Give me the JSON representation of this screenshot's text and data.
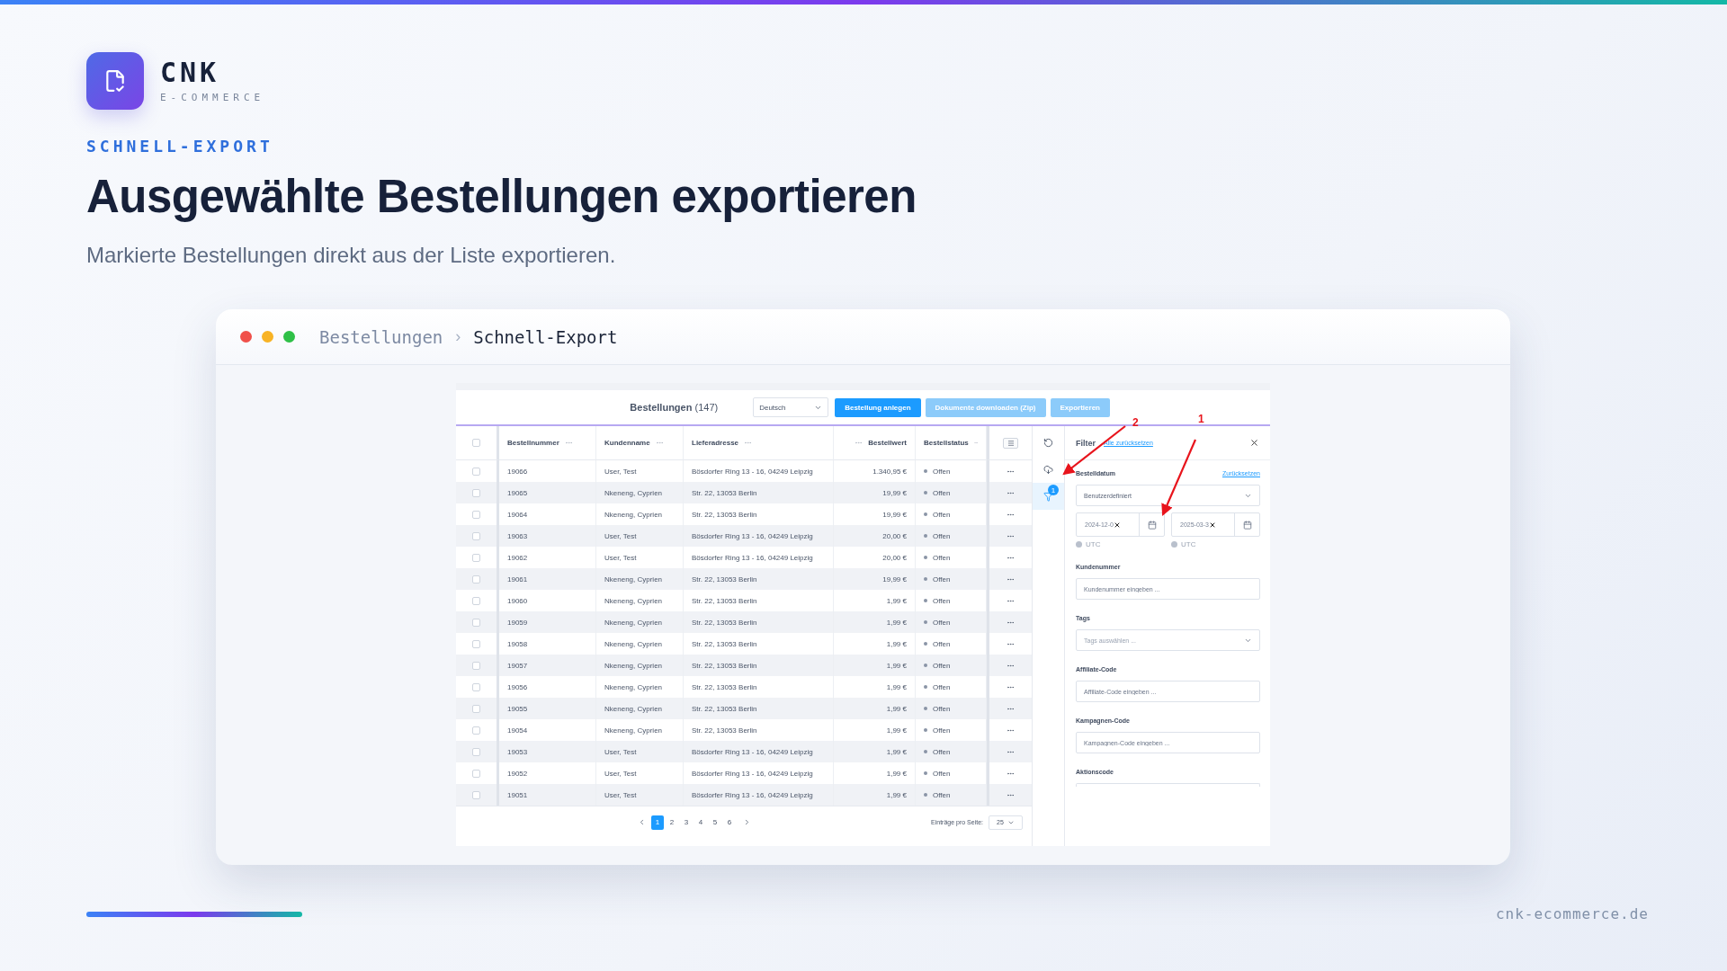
{
  "brand": {
    "name": "CNK",
    "tagline": "E-COMMERCE"
  },
  "eyebrow": "SCHNELL-EXPORT",
  "headline": "Ausgewählte Bestellungen exportieren",
  "subtitle": "Markierte Bestellungen direkt aus der Liste exportieren.",
  "window": {
    "breadcrumb": [
      {
        "label": "Bestellungen",
        "current": false
      },
      {
        "label": "Schnell-Export",
        "current": true
      }
    ],
    "separator": "›"
  },
  "app": {
    "title": "Bestellungen",
    "count": "(147)",
    "language": "Deutsch",
    "buttons": [
      {
        "label": "Bestellung anlegen",
        "disabled": false
      },
      {
        "label": "Dokumente downloaden (Zip)",
        "disabled": true
      },
      {
        "label": "Exportieren",
        "disabled": true
      }
    ],
    "select_all": false,
    "columns": [
      {
        "label": "Bestellnummer",
        "kind": "text"
      },
      {
        "label": "Kundenname",
        "kind": "text"
      },
      {
        "label": "Lieferadresse",
        "kind": "text"
      },
      {
        "label": "Bestellwert",
        "kind": "money"
      },
      {
        "label": "Bestellstatus",
        "kind": "status"
      }
    ],
    "rows": [
      {
        "checked": false,
        "cells": [
          "19066",
          "User, Test",
          "Bösdorfer Ring 13 - 16, 04249 Leipzig",
          "1.340,95 €",
          "Offen"
        ]
      },
      {
        "checked": false,
        "cells": [
          "19065",
          "Nkeneng, Cyprien",
          "Str. 22, 13053 Berlin",
          "19,99 €",
          "Offen"
        ]
      },
      {
        "checked": false,
        "cells": [
          "19064",
          "Nkeneng, Cyprien",
          "Str. 22, 13053 Berlin",
          "19,99 €",
          "Offen"
        ]
      },
      {
        "checked": false,
        "cells": [
          "19063",
          "User, Test",
          "Bösdorfer Ring 13 - 16, 04249 Leipzig",
          "20,00 €",
          "Offen"
        ]
      },
      {
        "checked": false,
        "cells": [
          "19062",
          "User, Test",
          "Bösdorfer Ring 13 - 16, 04249 Leipzig",
          "20,00 €",
          "Offen"
        ]
      },
      {
        "checked": false,
        "cells": [
          "19061",
          "Nkeneng, Cyprien",
          "Str. 22, 13053 Berlin",
          "19,99 €",
          "Offen"
        ]
      },
      {
        "checked": false,
        "cells": [
          "19060",
          "Nkeneng, Cyprien",
          "Str. 22, 13053 Berlin",
          "1,99 €",
          "Offen"
        ]
      },
      {
        "checked": false,
        "cells": [
          "19059",
          "Nkeneng, Cyprien",
          "Str. 22, 13053 Berlin",
          "1,99 €",
          "Offen"
        ]
      },
      {
        "checked": false,
        "cells": [
          "19058",
          "Nkeneng, Cyprien",
          "Str. 22, 13053 Berlin",
          "1,99 €",
          "Offen"
        ]
      },
      {
        "checked": false,
        "cells": [
          "19057",
          "Nkeneng, Cyprien",
          "Str. 22, 13053 Berlin",
          "1,99 €",
          "Offen"
        ]
      },
      {
        "checked": false,
        "cells": [
          "19056",
          "Nkeneng, Cyprien",
          "Str. 22, 13053 Berlin",
          "1,99 €",
          "Offen"
        ]
      },
      {
        "checked": false,
        "cells": [
          "19055",
          "Nkeneng, Cyprien",
          "Str. 22, 13053 Berlin",
          "1,99 €",
          "Offen"
        ]
      },
      {
        "checked": false,
        "cells": [
          "19054",
          "Nkeneng, Cyprien",
          "Str. 22, 13053 Berlin",
          "1,99 €",
          "Offen"
        ]
      },
      {
        "checked": false,
        "cells": [
          "19053",
          "User, Test",
          "Bösdorfer Ring 13 - 16, 04249 Leipzig",
          "1,99 €",
          "Offen"
        ]
      },
      {
        "checked": false,
        "cells": [
          "19052",
          "User, Test",
          "Bösdorfer Ring 13 - 16, 04249 Leipzig",
          "1,99 €",
          "Offen"
        ]
      },
      {
        "checked": false,
        "cells": [
          "19051",
          "User, Test",
          "Bösdorfer Ring 13 - 16, 04249 Leipzig",
          "1,99 €",
          "Offen"
        ]
      }
    ],
    "pagination": {
      "pages": [
        {
          "label": "1",
          "selected": true
        },
        {
          "label": "2",
          "selected": false
        },
        {
          "label": "3",
          "selected": false
        },
        {
          "label": "4",
          "selected": false
        },
        {
          "label": "5",
          "selected": false
        },
        {
          "label": "6",
          "selected": false
        }
      ],
      "per_page_label": "Einträge pro Seite:",
      "per_page": "25"
    },
    "side_tools": [
      {
        "kind": "refresh",
        "selected": false
      },
      {
        "kind": "download",
        "selected": false
      },
      {
        "kind": "filter",
        "selected": true,
        "badge": "1"
      }
    ],
    "filter": {
      "title": "Filter",
      "reset_all": "Alle zurücksetzen",
      "sections": [
        {
          "kind": "date",
          "label": "Bestelldatum",
          "reset": "Zurücksetzen",
          "value": "Benutzerdefiniert",
          "dates": [
            {
              "value": "2024-12-0",
              "hint": "UTC"
            },
            {
              "value": "2025-03-3",
              "hint": "UTC"
            }
          ]
        },
        {
          "kind": "input",
          "label": "Kundenummer",
          "placeholder": "Kundenummer eingeben ..."
        },
        {
          "kind": "select",
          "label": "Tags",
          "placeholder": "Tags auswählen ..."
        },
        {
          "kind": "input",
          "label": "Affiliate-Code",
          "placeholder": "Affiliate-Code eingeben ..."
        },
        {
          "kind": "input",
          "label": "Kampagnen-Code",
          "placeholder": "Kampagnen-Code eingeben ..."
        },
        {
          "kind": "cut",
          "label": "Aktionscode"
        }
      ]
    }
  },
  "annotations": [
    {
      "label": "1"
    },
    {
      "label": "2"
    }
  ],
  "footer": {
    "url": "cnk-ecommerce.de"
  }
}
